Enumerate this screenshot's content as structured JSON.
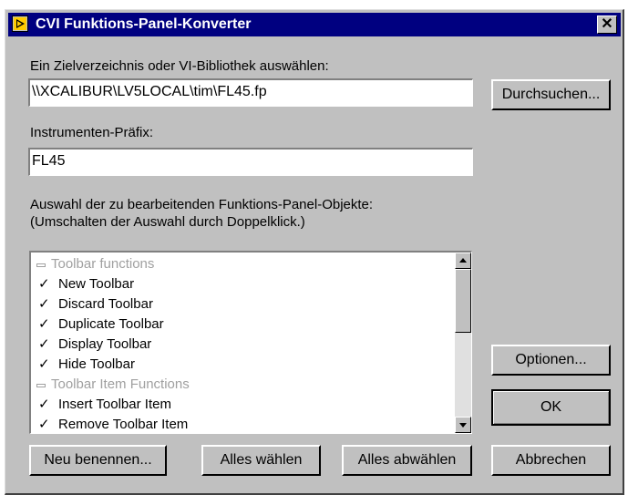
{
  "window": {
    "title": "CVI Funktions-Panel-Konverter",
    "close_glyph": "✕",
    "accent": "#000080"
  },
  "target": {
    "label": "Ein Zielverzeichnis oder VI-Bibliothek auswählen:",
    "value": "\\\\XCALIBUR\\LV5LOCAL\\tim\\FL45.fp",
    "browse_label": "Durchsuchen..."
  },
  "prefix": {
    "label": "Instrumenten-Präfix:",
    "value": "FL45"
  },
  "selection": {
    "label_line1": "Auswahl der zu bearbeitenden Funktions-Panel-Objekte:",
    "label_line2": "(Umschalten der Auswahl durch Doppelklick.)",
    "items": [
      {
        "type": "header",
        "text": "Toolbar functions"
      },
      {
        "type": "item",
        "check": "✓",
        "text": "New Toolbar"
      },
      {
        "type": "item",
        "check": "✓",
        "text": "Discard Toolbar"
      },
      {
        "type": "item",
        "check": "✓",
        "text": "Duplicate Toolbar"
      },
      {
        "type": "item",
        "check": "✓",
        "text": "Display Toolbar"
      },
      {
        "type": "item",
        "check": "✓",
        "text": "Hide Toolbar"
      },
      {
        "type": "header",
        "text": "Toolbar Item Functions"
      },
      {
        "type": "item",
        "check": "✓",
        "text": "Insert Toolbar Item"
      },
      {
        "type": "item",
        "check": "✓",
        "text": "Remove Toolbar Item"
      }
    ],
    "scroll_up_icon": "▲",
    "scroll_down_icon": "▼"
  },
  "buttons": {
    "options": "Optionen...",
    "ok": "OK",
    "rename": "Neu benennen...",
    "select_all": "Alles wählen",
    "deselect_all": "Alles  abwählen",
    "cancel": "Abbrechen"
  }
}
